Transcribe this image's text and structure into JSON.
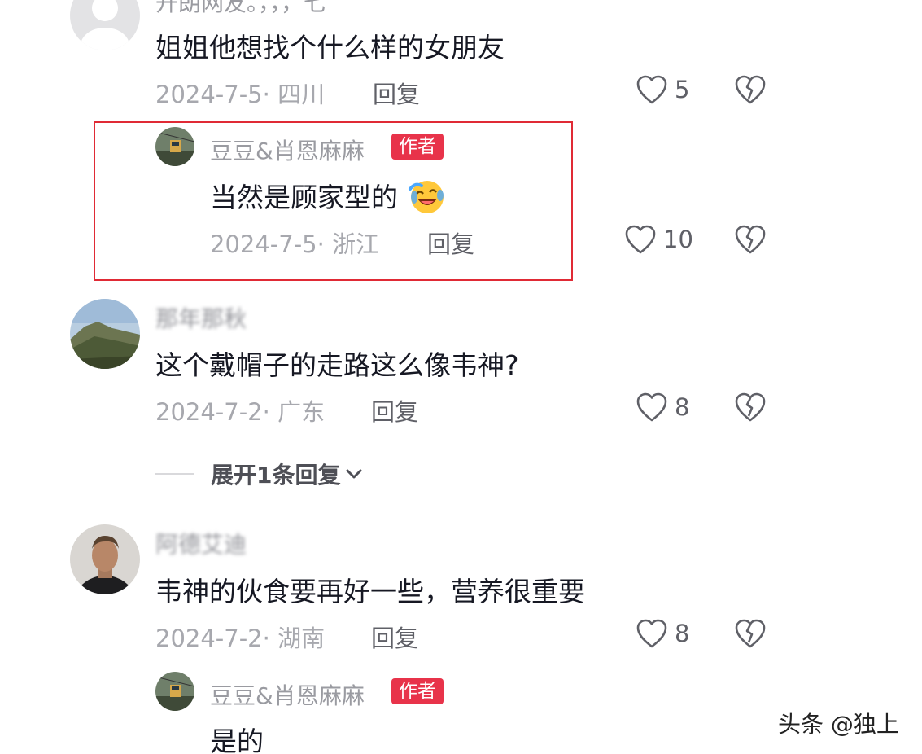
{
  "comments": [
    {
      "username": "开朗网友。，，，七",
      "text": "姐姐他想找个什么样的女朋友",
      "meta": "2024-7-5· 四川",
      "reply": "回复",
      "likes": "5",
      "replies": [
        {
          "username": "豆豆&肖恩麻麻",
          "badge": "作者",
          "text": "当然是顾家型的",
          "emoji": "laughing-crying-emoji",
          "meta": "2024-7-5· 浙江",
          "reply": "回复",
          "likes": "10"
        }
      ]
    },
    {
      "username": "那年那秋",
      "text": "这个戴帽子的走路这么像韦神?",
      "meta": "2024-7-2· 广东",
      "reply": "回复",
      "likes": "8",
      "expand_label": "展开1条回复"
    },
    {
      "username": "阿德艾迪",
      "text": "韦神的伙食要再好一些，营养很重要",
      "meta": "2024-7-2· 湖南",
      "reply": "回复",
      "likes": "8",
      "replies": [
        {
          "username": "豆豆&肖恩麻麻",
          "badge": "作者",
          "text": "是的"
        }
      ]
    }
  ],
  "watermark": "头条 @独上",
  "colors": {
    "highlight_border": "#e02a35",
    "author_badge": "#e8334a"
  }
}
